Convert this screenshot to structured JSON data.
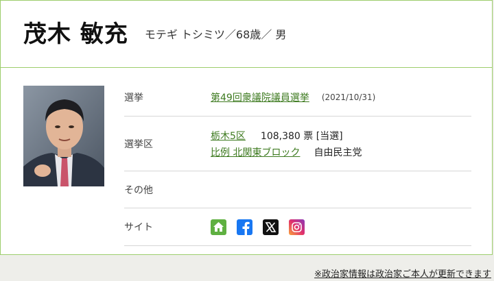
{
  "profile": {
    "name": "茂木 敏充",
    "meta": "モテギ トシミツ／68歳／ 男"
  },
  "rows": {
    "election": {
      "label": "選挙",
      "link": "第49回衆議院議員選挙",
      "date": "(2021/10/31)"
    },
    "district": {
      "label": "選挙区",
      "link1": "栃木5区",
      "votes": "108,380 票 [当選]",
      "link2": "比例 北関東ブロック",
      "party": "自由民主党"
    },
    "other": {
      "label": "その他"
    },
    "site": {
      "label": "サイト",
      "icons": [
        "home-icon",
        "facebook-icon",
        "x-icon",
        "instagram-icon"
      ]
    }
  },
  "footnote": "※政治家情報は政治家ご本人が更新できます",
  "colors": {
    "accent": "#9ccd6b",
    "link": "#3d7a1f",
    "home": "#5fb041",
    "facebook": "#1877f2",
    "x": "#111111"
  }
}
